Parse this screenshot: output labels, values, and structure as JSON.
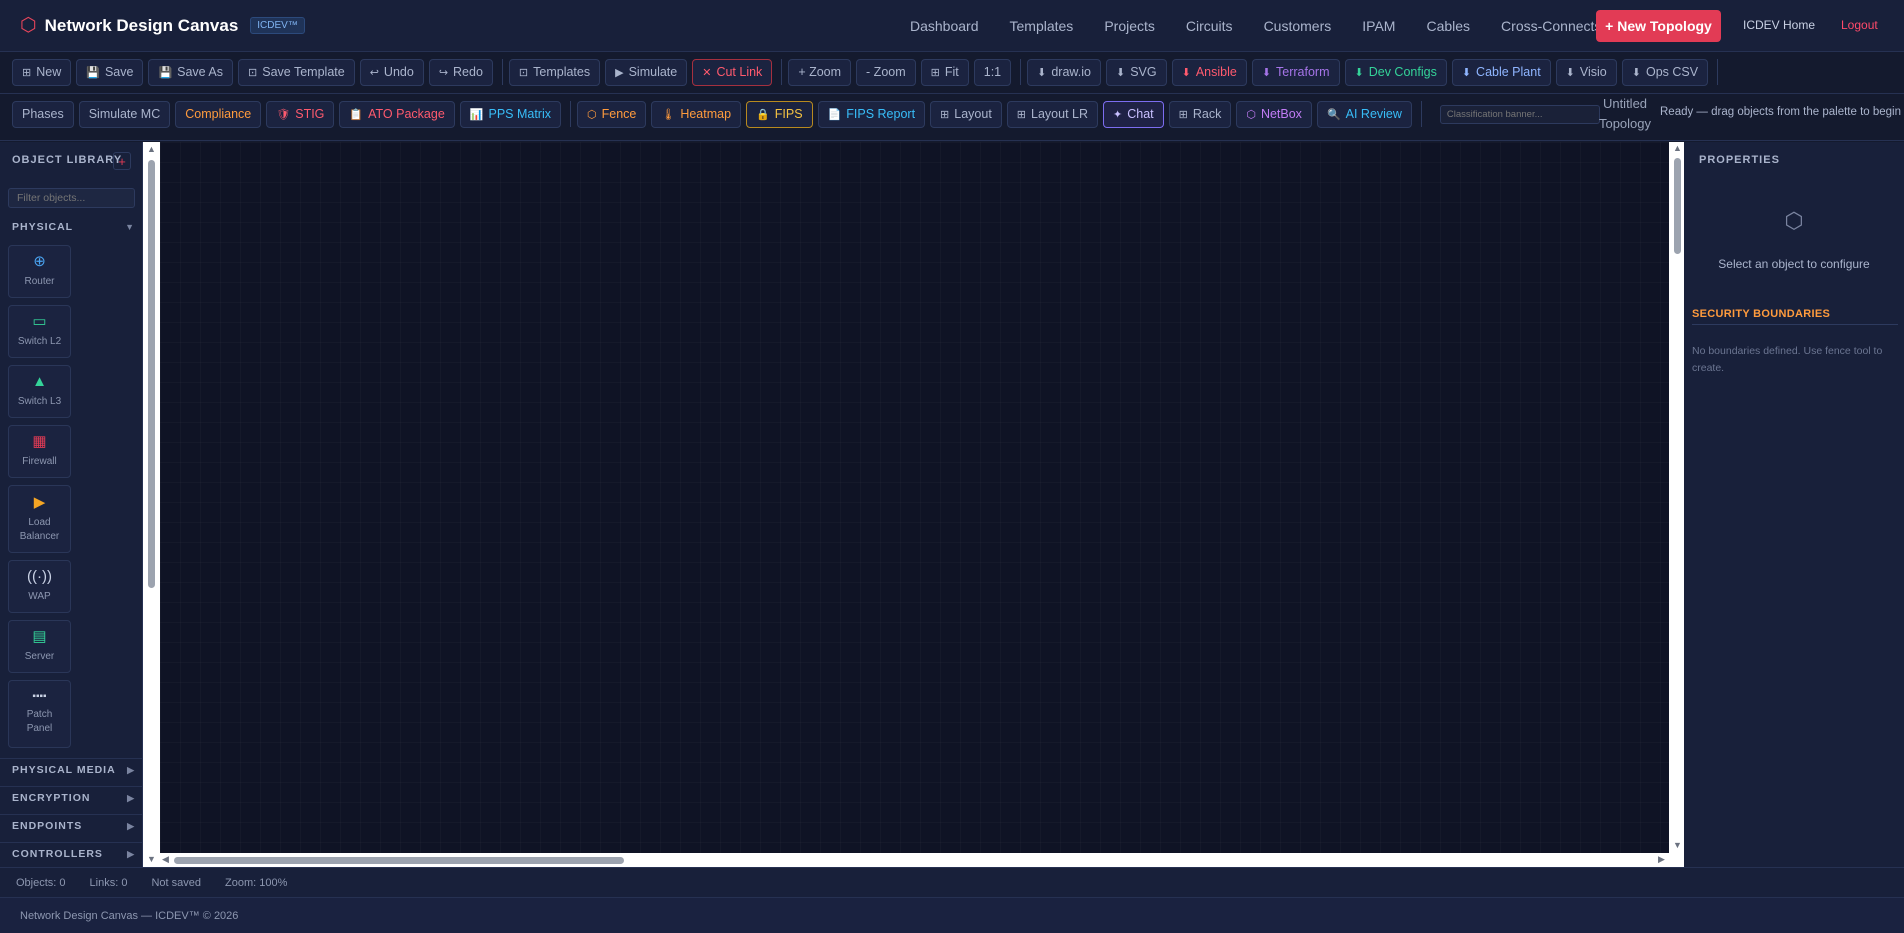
{
  "header": {
    "brand_icon": "⬡",
    "title": "Network Design Canvas",
    "badge": "ICDEV™",
    "nav": [
      "Dashboard",
      "Templates",
      "Projects",
      "Circuits",
      "Customers",
      "IPAM",
      "Cables",
      "Cross-Connects"
    ],
    "new_topology": "+ New Topology",
    "home": "ICDEV Home",
    "logout": "Logout"
  },
  "toolbar1": {
    "new": "New",
    "save": "Save",
    "save_as": "Save As",
    "save_template": "Save Template",
    "undo": "Undo",
    "redo": "Redo",
    "templates": "Templates",
    "simulate": "Simulate",
    "cut_link": "Cut Link",
    "zoom_in": "+ Zoom",
    "zoom_out": "- Zoom",
    "fit": "Fit",
    "one_to_one": "1:1",
    "drawio": "draw.io",
    "svg": "SVG",
    "ansible": "Ansible",
    "terraform": "Terraform",
    "dev_configs": "Dev Configs",
    "cable_plant": "Cable Plant",
    "visio": "Visio",
    "ops_csv": "Ops CSV"
  },
  "toolbar2": {
    "phases": "Phases",
    "simulate_mc": "Simulate MC",
    "compliance": "Compliance",
    "stig": "STIG",
    "ato_package": "ATO Package",
    "pps_matrix": "PPS Matrix",
    "fence": "Fence",
    "heatmap": "Heatmap",
    "fips": "FIPS",
    "fips_report": "FIPS Report",
    "layout": "Layout",
    "layout_lr": "Layout LR",
    "chat": "Chat",
    "rack": "Rack",
    "netbox": "NetBox",
    "ai_review": "AI Review",
    "classification_placeholder": "Classification banner...",
    "topology_name": "Untitled Topology",
    "status_message": "Ready — drag objects from the palette to begin"
  },
  "library": {
    "header": "OBJECT LIBRARY",
    "add": "+",
    "filter_placeholder": "Filter objects...",
    "physical_header": "PHYSICAL",
    "items": [
      {
        "label": "Router",
        "icon": "router-icon"
      },
      {
        "label": "Switch L2",
        "icon": "switch-l2-icon"
      },
      {
        "label": "Switch L3",
        "icon": "switch-l3-icon"
      },
      {
        "label": "Firewall",
        "icon": "firewall-icon"
      },
      {
        "label": "Load Balancer",
        "icon": "load-balancer-icon"
      },
      {
        "label": "WAP",
        "icon": "wap-icon"
      },
      {
        "label": "Server",
        "icon": "server-icon"
      },
      {
        "label": "Patch Panel",
        "icon": "patch-panel-icon"
      }
    ],
    "categories": [
      "PHYSICAL MEDIA",
      "ENCRYPTION",
      "ENDPOINTS",
      "CONTROLLERS"
    ]
  },
  "properties": {
    "header": "PROPERTIES",
    "empty": "Select an object to configure",
    "security_header": "SECURITY BOUNDARIES",
    "security_empty": "No boundaries defined. Use fence tool to create."
  },
  "status": {
    "objects": "Objects: 0",
    "links": "Links: 0",
    "saved": "Not saved",
    "zoom": "Zoom: 100%"
  },
  "footer": "Network Design Canvas — ICDEV™ © 2026",
  "colors": {
    "accent": "#e23b55",
    "background": "#141a2e",
    "canvas": "#0f1325",
    "warning": "#ff9b3d"
  }
}
